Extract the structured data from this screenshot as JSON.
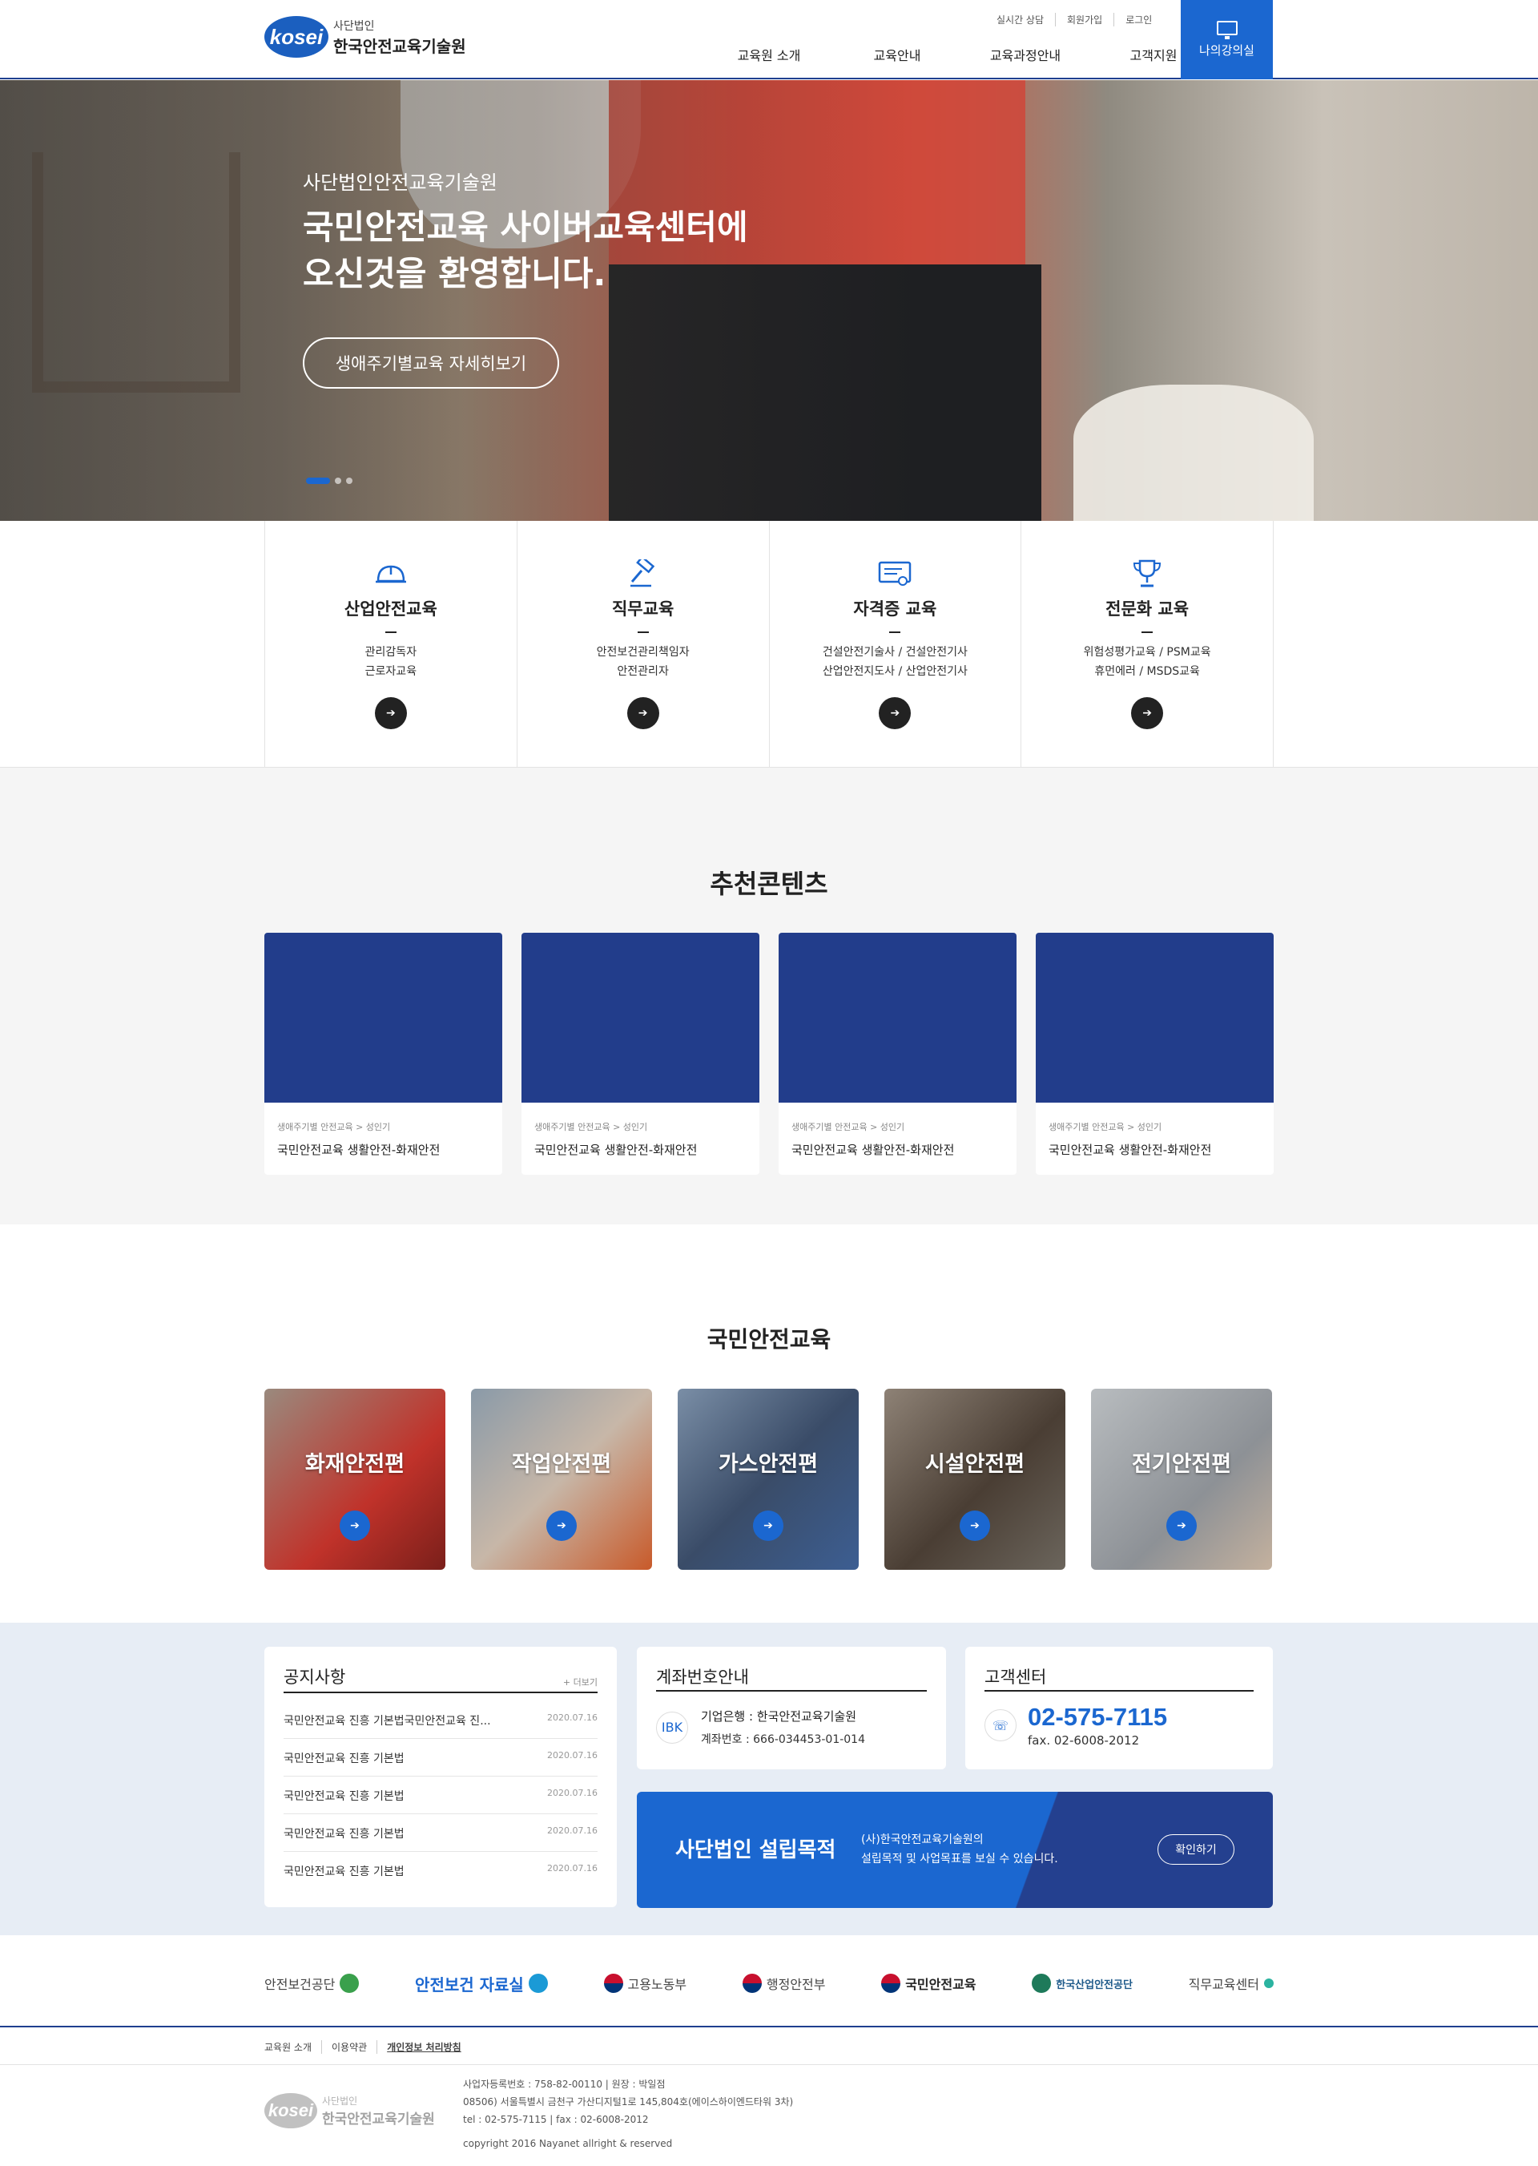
{
  "header": {
    "logo_mark": "kosei",
    "logo_small": "사단법인",
    "logo_big": "한국안전교육기술원",
    "util": [
      "실시간 상담",
      "회원가입",
      "로그인"
    ],
    "nav": [
      "교육원 소개",
      "교육안내",
      "교육과정안내",
      "고객지원"
    ],
    "my_room": "나의강의실"
  },
  "hero": {
    "subtitle": "사단법인안전교육기술원",
    "title_line1": "국민안전교육 사이버교육센터에",
    "title_line2": "오신것을 환영합니다.",
    "button": "생애주기별교육 자세히보기"
  },
  "categories": [
    {
      "title": "산업안전교육",
      "icon": "helmet-icon",
      "lines": [
        "관리감독자",
        "근로자교육"
      ]
    },
    {
      "title": "직무교육",
      "icon": "gavel-icon",
      "lines": [
        "안전보건관리책임자",
        "안전관리자"
      ]
    },
    {
      "title": "자격증 교육",
      "icon": "certificate-icon",
      "lines": [
        "건설안전기술사 / 건설안전기사",
        "산업안전지도사 / 산업안전기사"
      ]
    },
    {
      "title": "전문화 교육",
      "icon": "trophy-icon",
      "lines": [
        "위험성평가교육 / PSM교육",
        "휴먼에러 / MSDS교육"
      ]
    }
  ],
  "recommended": {
    "heading": "추천콘텐츠",
    "cards": [
      {
        "crumb": "생애주기별 안전교육 > 성인기",
        "title": "국민안전교육 생활안전-화재안전"
      },
      {
        "crumb": "생애주기별 안전교육 > 성인기",
        "title": "국민안전교육 생활안전-화재안전"
      },
      {
        "crumb": "생애주기별 안전교육 > 성인기",
        "title": "국민안전교육 생활안전-화재안전"
      },
      {
        "crumb": "생애주기별 안전교육 > 성인기",
        "title": "국민안전교육 생활안전-화재안전"
      }
    ]
  },
  "national": {
    "heading": "국민안전교육",
    "tiles": [
      "화재안전편",
      "작업안전편",
      "가스안전편",
      "시설안전편",
      "전기안전편"
    ]
  },
  "notice": {
    "heading": "공지사항",
    "more": "+ 더보기",
    "items": [
      {
        "title": "국민안전교육 진흥 기본법국민안전교육 진...",
        "date": "2020.07.16"
      },
      {
        "title": "국민안전교육 진흥 기본법",
        "date": "2020.07.16"
      },
      {
        "title": "국민안전교육 진흥 기본법",
        "date": "2020.07.16"
      },
      {
        "title": "국민안전교육 진흥 기본법",
        "date": "2020.07.16"
      },
      {
        "title": "국민안전교육 진흥 기본법",
        "date": "2020.07.16"
      }
    ]
  },
  "account": {
    "heading": "계좌번호안내",
    "bank": "기업은행 : 한국안전교육기술원",
    "number": "계좌번호 : 666-034453-01-014"
  },
  "cs": {
    "heading": "고객센터",
    "tel": "02-575-7115",
    "fax": "fax. 02-6008-2012"
  },
  "purpose": {
    "title": "사단법인 설립목적",
    "desc_line1": "(사)한국안전교육기술원의",
    "desc_line2": "설립목적 및 사업목표를 보실 수 있습니다.",
    "button": "확인하기"
  },
  "partners": [
    "안전보건공단",
    "안전보건 자료실",
    "고용노동부",
    "행정안전부",
    "국민안전교육",
    "한국산업안전공단",
    "직무교육센터"
  ],
  "footer": {
    "links": [
      "교육원 소개",
      "이용약관",
      "개인정보 처리방침"
    ],
    "biz": "사업자등록번호 : 758-82-00110 | 원장 : 박일점",
    "address": "08506) 서울특별시 금천구 가산디지털1로 145,804호(에이스하이엔드타워 3차)",
    "tel": "tel : 02-575-7115 | fax : 02-6008-2012",
    "copyright": "copyright 2016 Nayanet allright & reserved"
  }
}
